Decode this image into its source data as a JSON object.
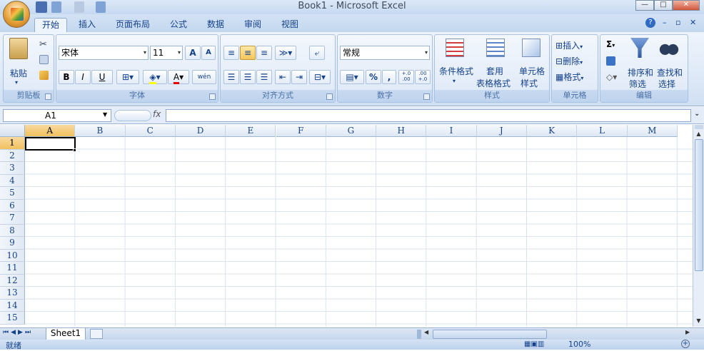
{
  "window": {
    "title": "Book1 - Microsoft Excel",
    "controls": [
      "—",
      "□",
      "✕"
    ]
  },
  "ribbon_tabs": [
    "开始",
    "插入",
    "页面布局",
    "公式",
    "数据",
    "审阅",
    "视图"
  ],
  "help_icons": [
    "?",
    "–",
    "▫",
    "✕"
  ],
  "clipboard": {
    "paste_label": "粘贴",
    "group_label": "剪贴板"
  },
  "font": {
    "name": "宋体",
    "size": "11",
    "grow": "A",
    "shrink": "A",
    "bold": "B",
    "italic": "I",
    "underline": "U",
    "phonetic": "wén",
    "group_label": "字体"
  },
  "alignment": {
    "group_label": "对齐方式"
  },
  "number": {
    "format": "常规",
    "percent": "%",
    "comma": ",",
    "inc_decimal": "+.0\n.00",
    "dec_decimal": ".00\n+.0",
    "group_label": "数字"
  },
  "styles": {
    "conditional": "条件格式",
    "table_1": "套用",
    "table_2": "表格格式",
    "cell_1": "单元格",
    "cell_2": "样式",
    "group_label": "样式"
  },
  "cells_group": {
    "insert": "插入",
    "delete": "删除",
    "format": "格式",
    "group_label": "单元格"
  },
  "editing": {
    "sum": "Σ",
    "sort_1": "排序和",
    "sort_2": "筛选",
    "find_1": "查找和",
    "find_2": "选择",
    "group_label": "编辑"
  },
  "formula_bar": {
    "name_box": "A1",
    "fx": "fx",
    "value": ""
  },
  "columns": [
    "A",
    "B",
    "C",
    "D",
    "E",
    "F",
    "G",
    "H",
    "I",
    "J",
    "K",
    "L",
    "M"
  ],
  "rows": [
    "1",
    "2",
    "3",
    "4",
    "5",
    "6",
    "7",
    "8",
    "9",
    "10",
    "11",
    "12",
    "13",
    "14",
    "15"
  ],
  "active_cell": "A1",
  "sheets": [
    "Sheet1"
  ],
  "status": {
    "ready": "就绪",
    "zoom": "100%"
  },
  "colors": {
    "accent": "#15428b",
    "selected_header": "#f1c15f",
    "ribbon_bg": "#dbe7f6"
  }
}
